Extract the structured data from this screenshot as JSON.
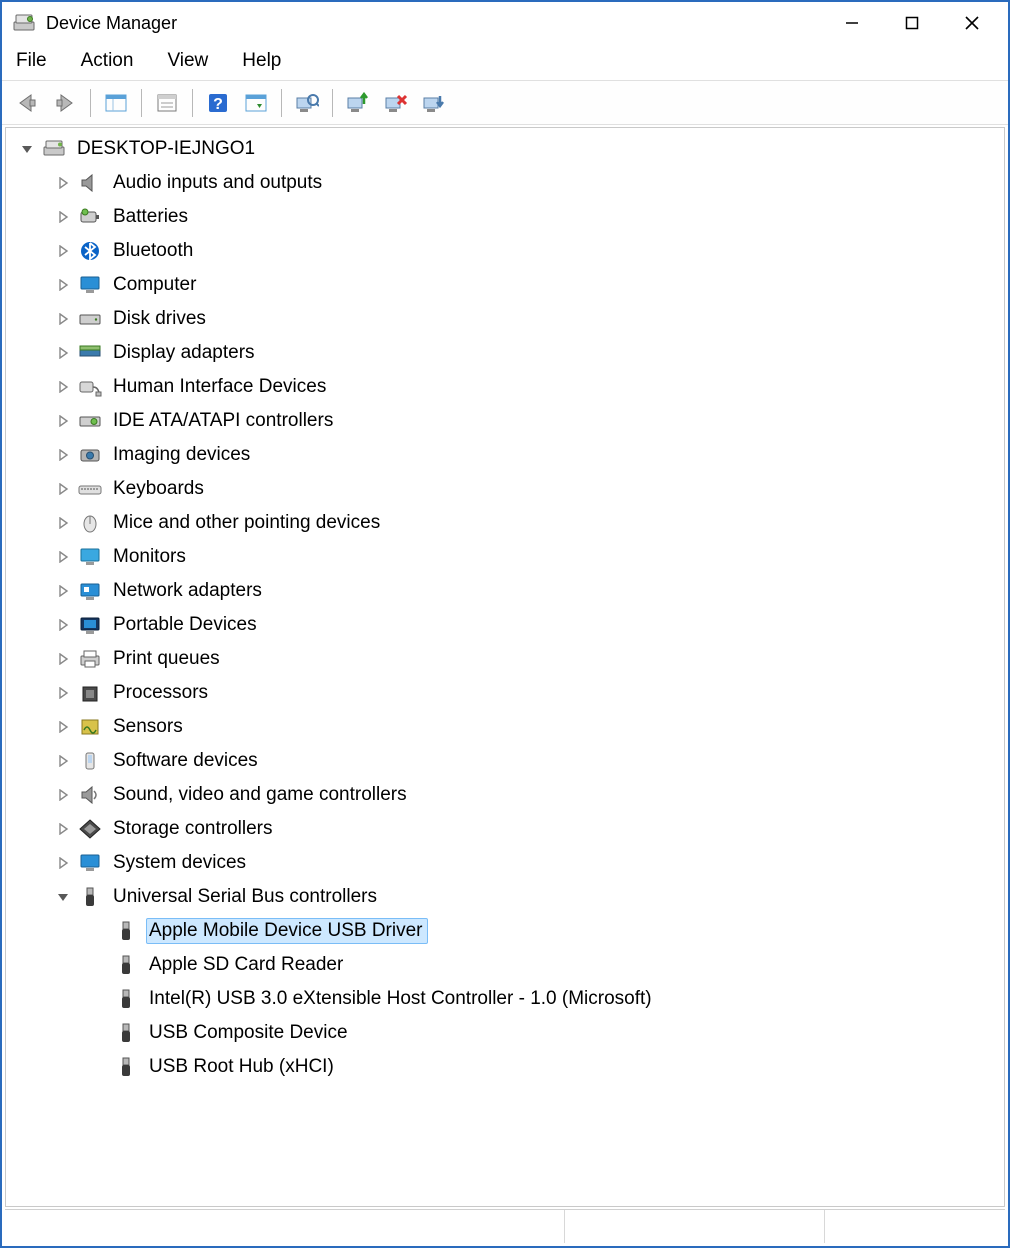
{
  "window": {
    "title": "Device Manager"
  },
  "menubar": {
    "file": "File",
    "action": "Action",
    "view": "View",
    "help": "Help"
  },
  "toolbar": {
    "back": "Back",
    "forward": "Forward",
    "show_hide": "Show/Hide Console Tree",
    "properties": "Properties",
    "help": "Help",
    "refresh": "Refresh",
    "scan": "Scan for hardware changes",
    "update": "Update driver",
    "uninstall": "Uninstall device",
    "disable": "Disable device"
  },
  "tree": {
    "root": "DESKTOP-IEJNGO1",
    "categories": [
      {
        "label": "Audio inputs and outputs",
        "icon": "audio"
      },
      {
        "label": "Batteries",
        "icon": "battery"
      },
      {
        "label": "Bluetooth",
        "icon": "bluetooth"
      },
      {
        "label": "Computer",
        "icon": "computer"
      },
      {
        "label": "Disk drives",
        "icon": "disk"
      },
      {
        "label": "Display adapters",
        "icon": "display"
      },
      {
        "label": "Human Interface Devices",
        "icon": "hid"
      },
      {
        "label": "IDE ATA/ATAPI controllers",
        "icon": "ide"
      },
      {
        "label": "Imaging devices",
        "icon": "imaging"
      },
      {
        "label": "Keyboards",
        "icon": "keyboard"
      },
      {
        "label": "Mice and other pointing devices",
        "icon": "mouse"
      },
      {
        "label": "Monitors",
        "icon": "monitor"
      },
      {
        "label": "Network adapters",
        "icon": "network"
      },
      {
        "label": "Portable Devices",
        "icon": "portable"
      },
      {
        "label": "Print queues",
        "icon": "printer"
      },
      {
        "label": "Processors",
        "icon": "cpu"
      },
      {
        "label": "Sensors",
        "icon": "sensor"
      },
      {
        "label": "Software devices",
        "icon": "software"
      },
      {
        "label": "Sound, video and game controllers",
        "icon": "sound"
      },
      {
        "label": "Storage controllers",
        "icon": "storage"
      },
      {
        "label": "System devices",
        "icon": "system"
      },
      {
        "label": "Universal Serial Bus controllers",
        "icon": "usb",
        "expanded": true
      }
    ],
    "usb_children": [
      {
        "label": "Apple Mobile Device USB Driver",
        "selected": true
      },
      {
        "label": "Apple SD Card Reader"
      },
      {
        "label": "Intel(R) USB 3.0 eXtensible Host Controller - 1.0 (Microsoft)"
      },
      {
        "label": "USB Composite Device"
      },
      {
        "label": "USB Root Hub (xHCI)"
      }
    ]
  }
}
